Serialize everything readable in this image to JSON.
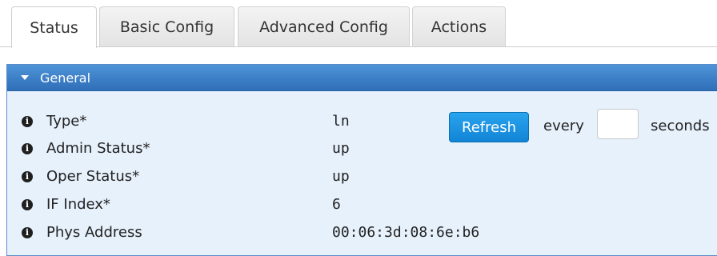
{
  "tabs": [
    {
      "label": "Status",
      "active": true
    },
    {
      "label": "Basic Config",
      "active": false
    },
    {
      "label": "Advanced Config",
      "active": false
    },
    {
      "label": "Actions",
      "active": false
    }
  ],
  "section": {
    "title": "General",
    "expanded": true
  },
  "rows": [
    {
      "label": "Type*",
      "value": "ln"
    },
    {
      "label": "Admin Status*",
      "value": "up"
    },
    {
      "label": "Oper Status*",
      "value": "up"
    },
    {
      "label": "IF Index*",
      "value": "6"
    },
    {
      "label": "Phys Address",
      "value": "00:06:3d:08:6e:b6"
    }
  ],
  "refresh": {
    "button_label": "Refresh",
    "every_label": "every",
    "interval_value": "",
    "seconds_label": "seconds"
  },
  "icons": {
    "info": "info-icon",
    "caret": "caret-down-icon"
  },
  "colors": {
    "panel_header": "#2f6fb8",
    "panel_body": "#e6f1fc",
    "refresh_button": "#1284d6"
  }
}
